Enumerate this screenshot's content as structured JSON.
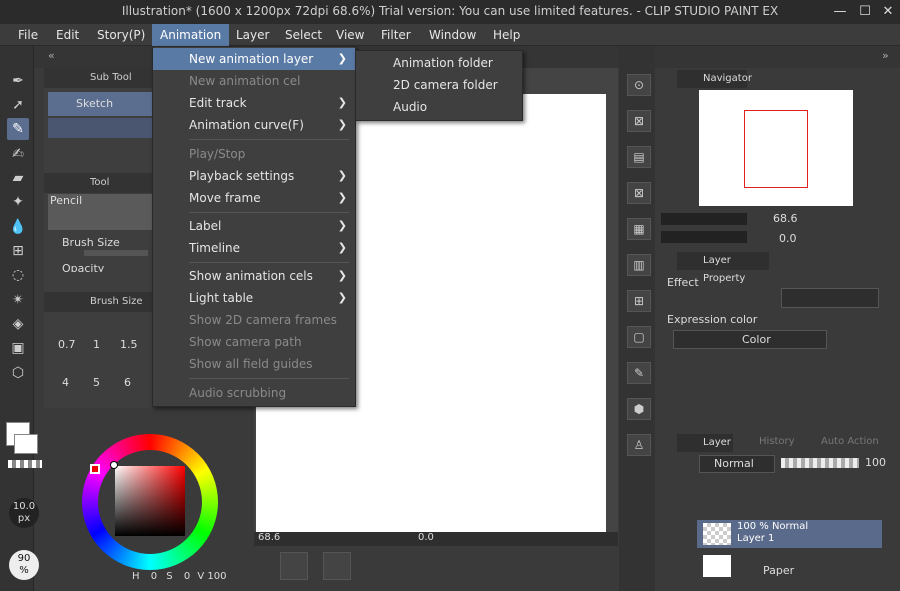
{
  "window": {
    "title": "Illustration* (1600 x 1200px 72dpi 68.6%)  Trial version: You can use limited features. - CLIP STUDIO PAINT EX",
    "minimize": "—",
    "maximize": "☐",
    "close": "✕"
  },
  "menubar": {
    "items": [
      "File",
      "Edit",
      "Story(P)",
      "Animation",
      "Layer",
      "Select",
      "View",
      "Filter",
      "Window",
      "Help"
    ]
  },
  "animation_menu": {
    "items": [
      {
        "label": "New animation layer",
        "state": "highlighted",
        "submenu": true
      },
      {
        "label": "New animation cel",
        "state": "disabled",
        "submenu": false
      },
      {
        "label": "Edit track",
        "state": "enabled",
        "submenu": true
      },
      {
        "label": "Animation curve(F)",
        "state": "enabled",
        "submenu": true
      },
      {
        "label": "Play/Stop",
        "state": "disabled",
        "submenu": false
      },
      {
        "label": "Playback settings",
        "state": "enabled",
        "submenu": true
      },
      {
        "label": "Move frame",
        "state": "enabled",
        "submenu": true
      },
      {
        "label": "Label",
        "state": "enabled",
        "submenu": true
      },
      {
        "label": "Timeline",
        "state": "enabled",
        "submenu": true
      },
      {
        "label": "Show animation cels",
        "state": "enabled",
        "submenu": true
      },
      {
        "label": "Light table",
        "state": "enabled",
        "submenu": true
      },
      {
        "label": "Show 2D camera frames",
        "state": "disabled",
        "submenu": false
      },
      {
        "label": "Show camera path",
        "state": "disabled",
        "submenu": false
      },
      {
        "label": "Show all field guides",
        "state": "disabled",
        "submenu": false
      },
      {
        "label": "Audio scrubbing",
        "state": "disabled",
        "submenu": false
      }
    ]
  },
  "submenu": {
    "items": [
      "Animation folder",
      "2D camera folder",
      "Audio"
    ]
  },
  "subtool": {
    "title": "Sub Tool",
    "selected": "Sketch",
    "tool_property_title": "Tool Property",
    "tool_name": "Pencil",
    "brush_size_label": "Brush Size",
    "opacity_label": "Opacity",
    "brush_size_panel_title": "Brush Size",
    "sizes": [
      "0.7",
      "1",
      "1.5",
      "4",
      "5",
      "6"
    ]
  },
  "left_bottom": {
    "brush_size_value": "10.0",
    "brush_unit": "px",
    "opacity_value": "90",
    "opacity_unit": "%"
  },
  "color": {
    "h_label": "H",
    "h": "0",
    "s_label": "S",
    "s": "0",
    "v_label": "V",
    "v": "100"
  },
  "canvas_status": {
    "zoom": "68.6",
    "angle": "0.0"
  },
  "navigator": {
    "title": "Navigator",
    "zoom": "68.6",
    "rotation": "0.0"
  },
  "layer_property": {
    "title": "Layer Property",
    "effect_label": "Effect",
    "expression_color_label": "Expression color",
    "expression_color_value": "Color"
  },
  "layer_panel": {
    "tabs": [
      "Layer",
      "History",
      "Auto Action"
    ],
    "blend_mode": "Normal",
    "opacity": "100",
    "layers": [
      {
        "meta": "100 % Normal",
        "name": "Layer 1",
        "selected": true
      },
      {
        "meta": "",
        "name": "Paper",
        "selected": false
      }
    ]
  },
  "colors": {
    "accent": "#5a7aa6",
    "background": "#3a3a3a",
    "navigator_frame": "#e02020"
  }
}
